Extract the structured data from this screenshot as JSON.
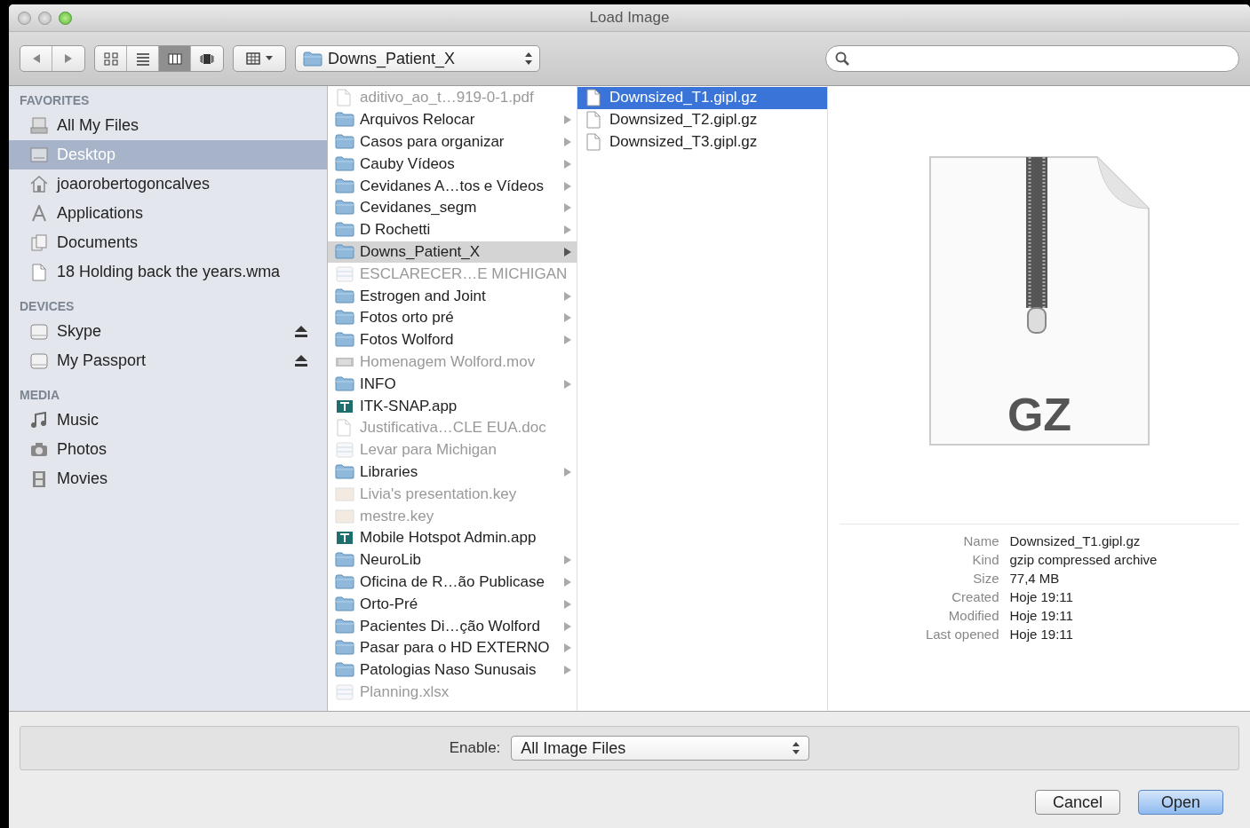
{
  "window": {
    "title": "Load Image"
  },
  "toolbar": {
    "view_buttons": [
      {
        "kind": "icons",
        "selected": false
      },
      {
        "kind": "list",
        "selected": false
      },
      {
        "kind": "columns",
        "selected": true
      },
      {
        "kind": "coverflow",
        "selected": false
      }
    ],
    "path": "Downs_Patient_X"
  },
  "sidebar": {
    "sections": [
      {
        "title": "FAVORITES",
        "items": [
          {
            "label": "All My Files",
            "kind": "all-files",
            "selected": false
          },
          {
            "label": "Desktop",
            "kind": "desktop",
            "selected": true
          },
          {
            "label": "joaorobertogoncalves",
            "kind": "home",
            "selected": false
          },
          {
            "label": "Applications",
            "kind": "applications",
            "selected": false
          },
          {
            "label": "Documents",
            "kind": "documents",
            "selected": false
          },
          {
            "label": "18 Holding back the years.wma",
            "kind": "file",
            "selected": false
          }
        ]
      },
      {
        "title": "DEVICES",
        "items": [
          {
            "label": "Skype",
            "kind": "drive",
            "selected": false,
            "ejectable": true
          },
          {
            "label": "My Passport",
            "kind": "drive",
            "selected": false,
            "ejectable": true
          }
        ]
      },
      {
        "title": "MEDIA",
        "items": [
          {
            "label": "Music",
            "kind": "music",
            "selected": false
          },
          {
            "label": "Photos",
            "kind": "photos",
            "selected": false
          },
          {
            "label": "Movies",
            "kind": "movies",
            "selected": false
          }
        ]
      }
    ]
  },
  "columns": [
    {
      "items": [
        {
          "name": "aditivo_ao_t…919-0-1.pdf",
          "kind": "document",
          "disabled": true,
          "selected": false
        },
        {
          "name": "Arquivos Relocar",
          "kind": "folder",
          "disabled": false,
          "selected": false
        },
        {
          "name": "Casos para organizar",
          "kind": "folder",
          "disabled": false,
          "selected": false
        },
        {
          "name": "Cauby Vídeos",
          "kind": "folder",
          "disabled": false,
          "selected": false
        },
        {
          "name": "Cevidanes A…tos e Vídeos",
          "kind": "folder",
          "disabled": false,
          "selected": false
        },
        {
          "name": "Cevidanes_segm",
          "kind": "folder",
          "disabled": false,
          "selected": false
        },
        {
          "name": "D Rochetti",
          "kind": "folder",
          "disabled": false,
          "selected": false
        },
        {
          "name": "Downs_Patient_X",
          "kind": "folder",
          "disabled": false,
          "selected": true
        },
        {
          "name": "ESCLARECER…E MICHIGAN",
          "kind": "spreadsheet",
          "disabled": true,
          "selected": false
        },
        {
          "name": "Estrogen and Joint",
          "kind": "folder",
          "disabled": false,
          "selected": false
        },
        {
          "name": "Fotos orto pré",
          "kind": "folder",
          "disabled": false,
          "selected": false
        },
        {
          "name": "Fotos Wolford",
          "kind": "folder",
          "disabled": false,
          "selected": false
        },
        {
          "name": "Homenagem Wolford.mov",
          "kind": "movie",
          "disabled": true,
          "selected": false
        },
        {
          "name": "INFO",
          "kind": "folder",
          "disabled": false,
          "selected": false
        },
        {
          "name": "ITK-SNAP.app",
          "kind": "app",
          "disabled": false,
          "selected": false
        },
        {
          "name": "Justificativa…CLE EUA.doc",
          "kind": "document",
          "disabled": true,
          "selected": false
        },
        {
          "name": "Levar para Michigan",
          "kind": "spreadsheet",
          "disabled": true,
          "selected": false
        },
        {
          "name": "Libraries",
          "kind": "folder",
          "disabled": false,
          "selected": false
        },
        {
          "name": "Livia's presentation.key",
          "kind": "presentation",
          "disabled": true,
          "selected": false
        },
        {
          "name": "mestre.key",
          "kind": "presentation",
          "disabled": true,
          "selected": false
        },
        {
          "name": "Mobile Hotspot Admin.app",
          "kind": "app",
          "disabled": false,
          "selected": false
        },
        {
          "name": "NeuroLib",
          "kind": "folder",
          "disabled": false,
          "selected": false
        },
        {
          "name": "Oficina de R…ão Publicase",
          "kind": "folder",
          "disabled": false,
          "selected": false
        },
        {
          "name": "Orto-Pré",
          "kind": "folder",
          "disabled": false,
          "selected": false
        },
        {
          "name": "Pacientes Di…ção Wolford",
          "kind": "folder",
          "disabled": false,
          "selected": false
        },
        {
          "name": "Pasar para o HD EXTERNO",
          "kind": "folder",
          "disabled": false,
          "selected": false
        },
        {
          "name": "Patologias Naso Sunusais",
          "kind": "folder",
          "disabled": false,
          "selected": false
        },
        {
          "name": "Planning.xlsx",
          "kind": "spreadsheet",
          "disabled": true,
          "selected": false
        }
      ]
    },
    {
      "items": [
        {
          "name": "Downsized_T1.gipl.gz",
          "kind": "document",
          "disabled": false,
          "selected": true
        },
        {
          "name": "Downsized_T2.gipl.gz",
          "kind": "document",
          "disabled": false,
          "selected": false
        },
        {
          "name": "Downsized_T3.gipl.gz",
          "kind": "document",
          "disabled": false,
          "selected": false
        }
      ]
    }
  ],
  "preview": {
    "badge": "GZ",
    "info": [
      {
        "label": "Name",
        "value": "Downsized_T1.gipl.gz"
      },
      {
        "label": "Kind",
        "value": "gzip compressed archive"
      },
      {
        "label": "Size",
        "value": "77,4 MB"
      },
      {
        "label": "Created",
        "value": "Hoje 19:11"
      },
      {
        "label": "Modified",
        "value": "Hoje 19:11"
      },
      {
        "label": "Last opened",
        "value": "Hoje 19:11"
      }
    ]
  },
  "filter": {
    "label": "Enable:",
    "value": "All Image Files"
  },
  "buttons": [
    {
      "label": "Cancel",
      "default": false
    },
    {
      "label": "Open",
      "default": true
    }
  ]
}
